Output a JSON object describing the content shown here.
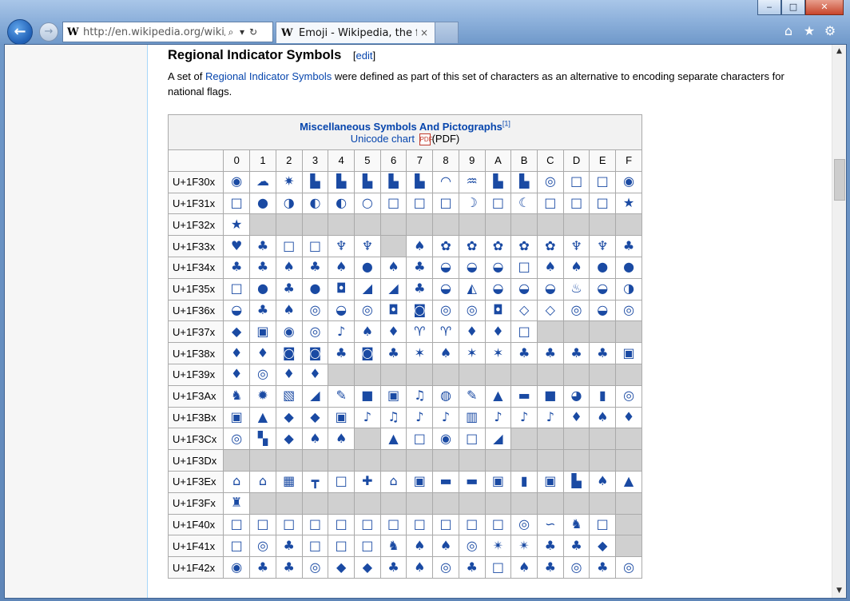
{
  "browser": {
    "address_url": "http://en.wikipedia.org/wiki/En",
    "address_favicon": "W",
    "tab_favicon": "W",
    "tab_title": "Emoji - Wikipedia, the fr...",
    "tab_close": "×",
    "icons": [
      "home-icon",
      "star-icon",
      "gear-icon"
    ]
  },
  "section": {
    "heading": "Regional Indicator Symbols",
    "edit_label": "edit",
    "intro_before": "A set of ",
    "intro_link": "Regional Indicator Symbols",
    "intro_after": " were defined as part of this set of characters as an alternative to encoding separate characters for national flags."
  },
  "chart": {
    "title": "Miscellaneous Symbols And Pictographs",
    "ref": "[1]",
    "link": "Unicode chart",
    "pdf": "(PDF)",
    "columns": [
      "0",
      "1",
      "2",
      "3",
      "4",
      "5",
      "6",
      "7",
      "8",
      "9",
      "A",
      "B",
      "C",
      "D",
      "E",
      "F"
    ],
    "rows": [
      {
        "label": "U+1F30x",
        "cells": [
          "◉",
          "☁",
          "✷",
          "▙",
          "▙",
          "▙",
          "▙",
          "▙",
          "◠",
          "♒",
          "▙",
          "▙",
          "◎",
          "□",
          "□",
          "◉"
        ]
      },
      {
        "label": "U+1F31x",
        "cells": [
          "□",
          "●",
          "◑",
          "◐",
          "◐",
          "○",
          "□",
          "□",
          "□",
          "☽",
          "□",
          "☾",
          "□",
          "□",
          "□",
          "★"
        ]
      },
      {
        "label": "U+1F32x",
        "cells": [
          "★",
          "",
          "",
          "",
          "",
          "",
          "",
          "",
          "",
          "",
          "",
          "",
          "",
          "",
          "",
          ""
        ]
      },
      {
        "label": "U+1F33x",
        "cells": [
          "♥",
          "♣",
          "□",
          "□",
          "♆",
          "♆",
          "",
          "♠",
          "✿",
          "✿",
          "✿",
          "✿",
          "✿",
          "♆",
          "♆",
          "♣"
        ]
      },
      {
        "label": "U+1F34x",
        "cells": [
          "♣",
          "♣",
          "♠",
          "♣",
          "♠",
          "●",
          "♠",
          "♣",
          "◒",
          "◒",
          "◒",
          "□",
          "♠",
          "♠",
          "●",
          "●"
        ]
      },
      {
        "label": "U+1F35x",
        "cells": [
          "□",
          "●",
          "♣",
          "●",
          "◘",
          "◢",
          "◢",
          "♣",
          "◒",
          "◭",
          "◒",
          "◒",
          "◒",
          "♨",
          "◒",
          "◑"
        ]
      },
      {
        "label": "U+1F36x",
        "cells": [
          "◒",
          "♣",
          "♠",
          "◎",
          "◒",
          "◎",
          "◘",
          "◙",
          "◎",
          "◎",
          "◘",
          "◇",
          "◇",
          "◎",
          "◒",
          "◎"
        ]
      },
      {
        "label": "U+1F37x",
        "cells": [
          "◆",
          "▣",
          "◉",
          "◎",
          "♪",
          "♠",
          "♦",
          "♈",
          "♈",
          "♦",
          "♦",
          "□",
          "",
          "",
          "",
          ""
        ]
      },
      {
        "label": "U+1F38x",
        "cells": [
          "♦",
          "♦",
          "◙",
          "◙",
          "♣",
          "◙",
          "♣",
          "✶",
          "♠",
          "✶",
          "✶",
          "♣",
          "♣",
          "♣",
          "♣",
          "▣"
        ]
      },
      {
        "label": "U+1F39x",
        "cells": [
          "♦",
          "◎",
          "♦",
          "♦",
          "",
          "",
          "",
          "",
          "",
          "",
          "",
          "",
          "",
          "",
          "",
          ""
        ]
      },
      {
        "label": "U+1F3Ax",
        "cells": [
          "♞",
          "✹",
          "▧",
          "◢",
          "✎",
          "■",
          "▣",
          "♫",
          "◍",
          "✎",
          "▲",
          "▬",
          "■",
          "◕",
          "▮",
          "◎"
        ]
      },
      {
        "label": "U+1F3Bx",
        "cells": [
          "▣",
          "▲",
          "◆",
          "◆",
          "▣",
          "♪",
          "♫",
          "♪",
          "♪",
          "▥",
          "♪",
          "♪",
          "♪",
          "♦",
          "♠",
          "♦"
        ]
      },
      {
        "label": "U+1F3Cx",
        "cells": [
          "◎",
          "▚",
          "◆",
          "♠",
          "♠",
          "",
          "▲",
          "□",
          "◉",
          "□",
          "◢",
          "",
          "",
          "",
          "",
          ""
        ]
      },
      {
        "label": "U+1F3Dx",
        "cells": [
          "",
          "",
          "",
          "",
          "",
          "",
          "",
          "",
          "",
          "",
          "",
          "",
          "",
          "",
          "",
          ""
        ]
      },
      {
        "label": "U+1F3Ex",
        "cells": [
          "⌂",
          "⌂",
          "▦",
          "┳",
          "□",
          "✚",
          "⌂",
          "▣",
          "▬",
          "▬",
          "▣",
          "▮",
          "▣",
          "▙",
          "♠",
          "▲"
        ]
      },
      {
        "label": "U+1F3Fx",
        "cells": [
          "♜",
          "",
          "",
          "",
          "",
          "",
          "",
          "",
          "",
          "",
          "",
          "",
          "",
          "",
          "",
          ""
        ]
      },
      {
        "label": "U+1F40x",
        "cells": [
          "□",
          "□",
          "□",
          "□",
          "□",
          "□",
          "□",
          "□",
          "□",
          "□",
          "□",
          "◎",
          "∽",
          "♞",
          "□",
          ""
        ]
      },
      {
        "label": "U+1F41x",
        "cells": [
          "□",
          "◎",
          "♣",
          "□",
          "□",
          "□",
          "♞",
          "♠",
          "♠",
          "◎",
          "✴",
          "✴",
          "♣",
          "♣",
          "◆",
          ""
        ]
      },
      {
        "label": "U+1F42x",
        "cells": [
          "◉",
          "♣",
          "♣",
          "◎",
          "◆",
          "◆",
          "♣",
          "♠",
          "◎",
          "♣",
          "□",
          "♠",
          "♣",
          "◎",
          "♣",
          "◎"
        ]
      }
    ]
  }
}
